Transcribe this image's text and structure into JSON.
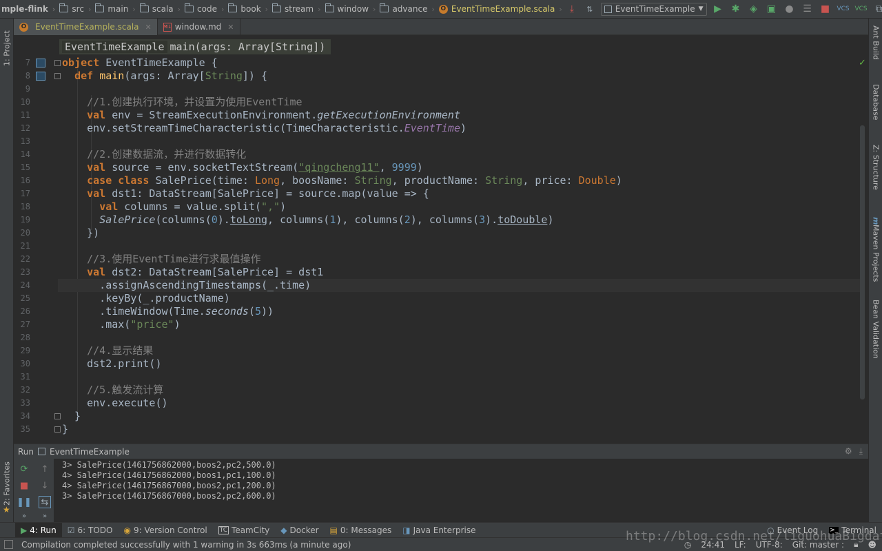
{
  "navbar": {
    "project": "mple-flink",
    "crumbs": [
      "src",
      "main",
      "scala",
      "code",
      "book",
      "stream",
      "window",
      "advance"
    ],
    "file": "EventTimeExample.scala",
    "run_config": "EventTimeExample"
  },
  "left_stripe": {
    "project": "1: Project",
    "favorites": "2: Favorites"
  },
  "right_stripe": {
    "ant": "Ant Build",
    "database": "Database",
    "structure": "Z: Structure",
    "maven": "Maven Projects",
    "bean": "Bean Validation"
  },
  "tabs": [
    {
      "label": "EventTimeExample.scala"
    },
    {
      "label": "window.md"
    }
  ],
  "editor": {
    "hint_object": "EventTimeExample",
    "hint_method": "main(args: Array[String])",
    "line_numbers": [
      "7",
      "8",
      "9",
      "10",
      "11",
      "12",
      "13",
      "14",
      "15",
      "16",
      "17",
      "18",
      "19",
      "20",
      "21",
      "22",
      "23",
      "24",
      "25",
      "26",
      "27",
      "28",
      "29",
      "30",
      "31",
      "32",
      "33",
      "34",
      "35"
    ],
    "comments": {
      "c1": "//1.创建执行环境，并设置为使用EventTime",
      "c2": "//2.创建数据流，并进行数据转化",
      "c3": "//3.使用EventTime进行求最值操作",
      "c4": "//4.显示结果",
      "c5": "//5.触发流计算"
    },
    "strings": {
      "host": "\"qingcheng11\"",
      "port": "9999",
      "sep": "\",\"",
      "price": "\"price\"",
      "five": "5"
    }
  },
  "run": {
    "header_label": "Run",
    "config": "EventTimeExample",
    "output": [
      "3> SalePrice(1461756862000,boos2,pc2,500.0)",
      "4> SalePrice(1461756862000,boos1,pc1,100.0)",
      "4> SalePrice(1461756867000,boos2,pc1,200.0)",
      "3> SalePrice(1461756867000,boos2,pc2,600.0)"
    ]
  },
  "bottom_tools": {
    "run": "4: Run",
    "todo": "6: TODO",
    "vcs": "9: Version Control",
    "teamcity": "TeamCity",
    "docker": "Docker",
    "messages": "0: Messages",
    "java_ee": "Java Enterprise",
    "event_log": "Event Log",
    "terminal": "Terminal"
  },
  "status": {
    "message": "Compilation completed successfully with 1 warning in 3s 663ms (a minute ago)",
    "position": "24:41",
    "line_sep": "LF:",
    "encoding": "UTF-8:",
    "git": "Git: master :"
  },
  "watermark": "http://blog.csdn.net/liguohuaBigdata"
}
